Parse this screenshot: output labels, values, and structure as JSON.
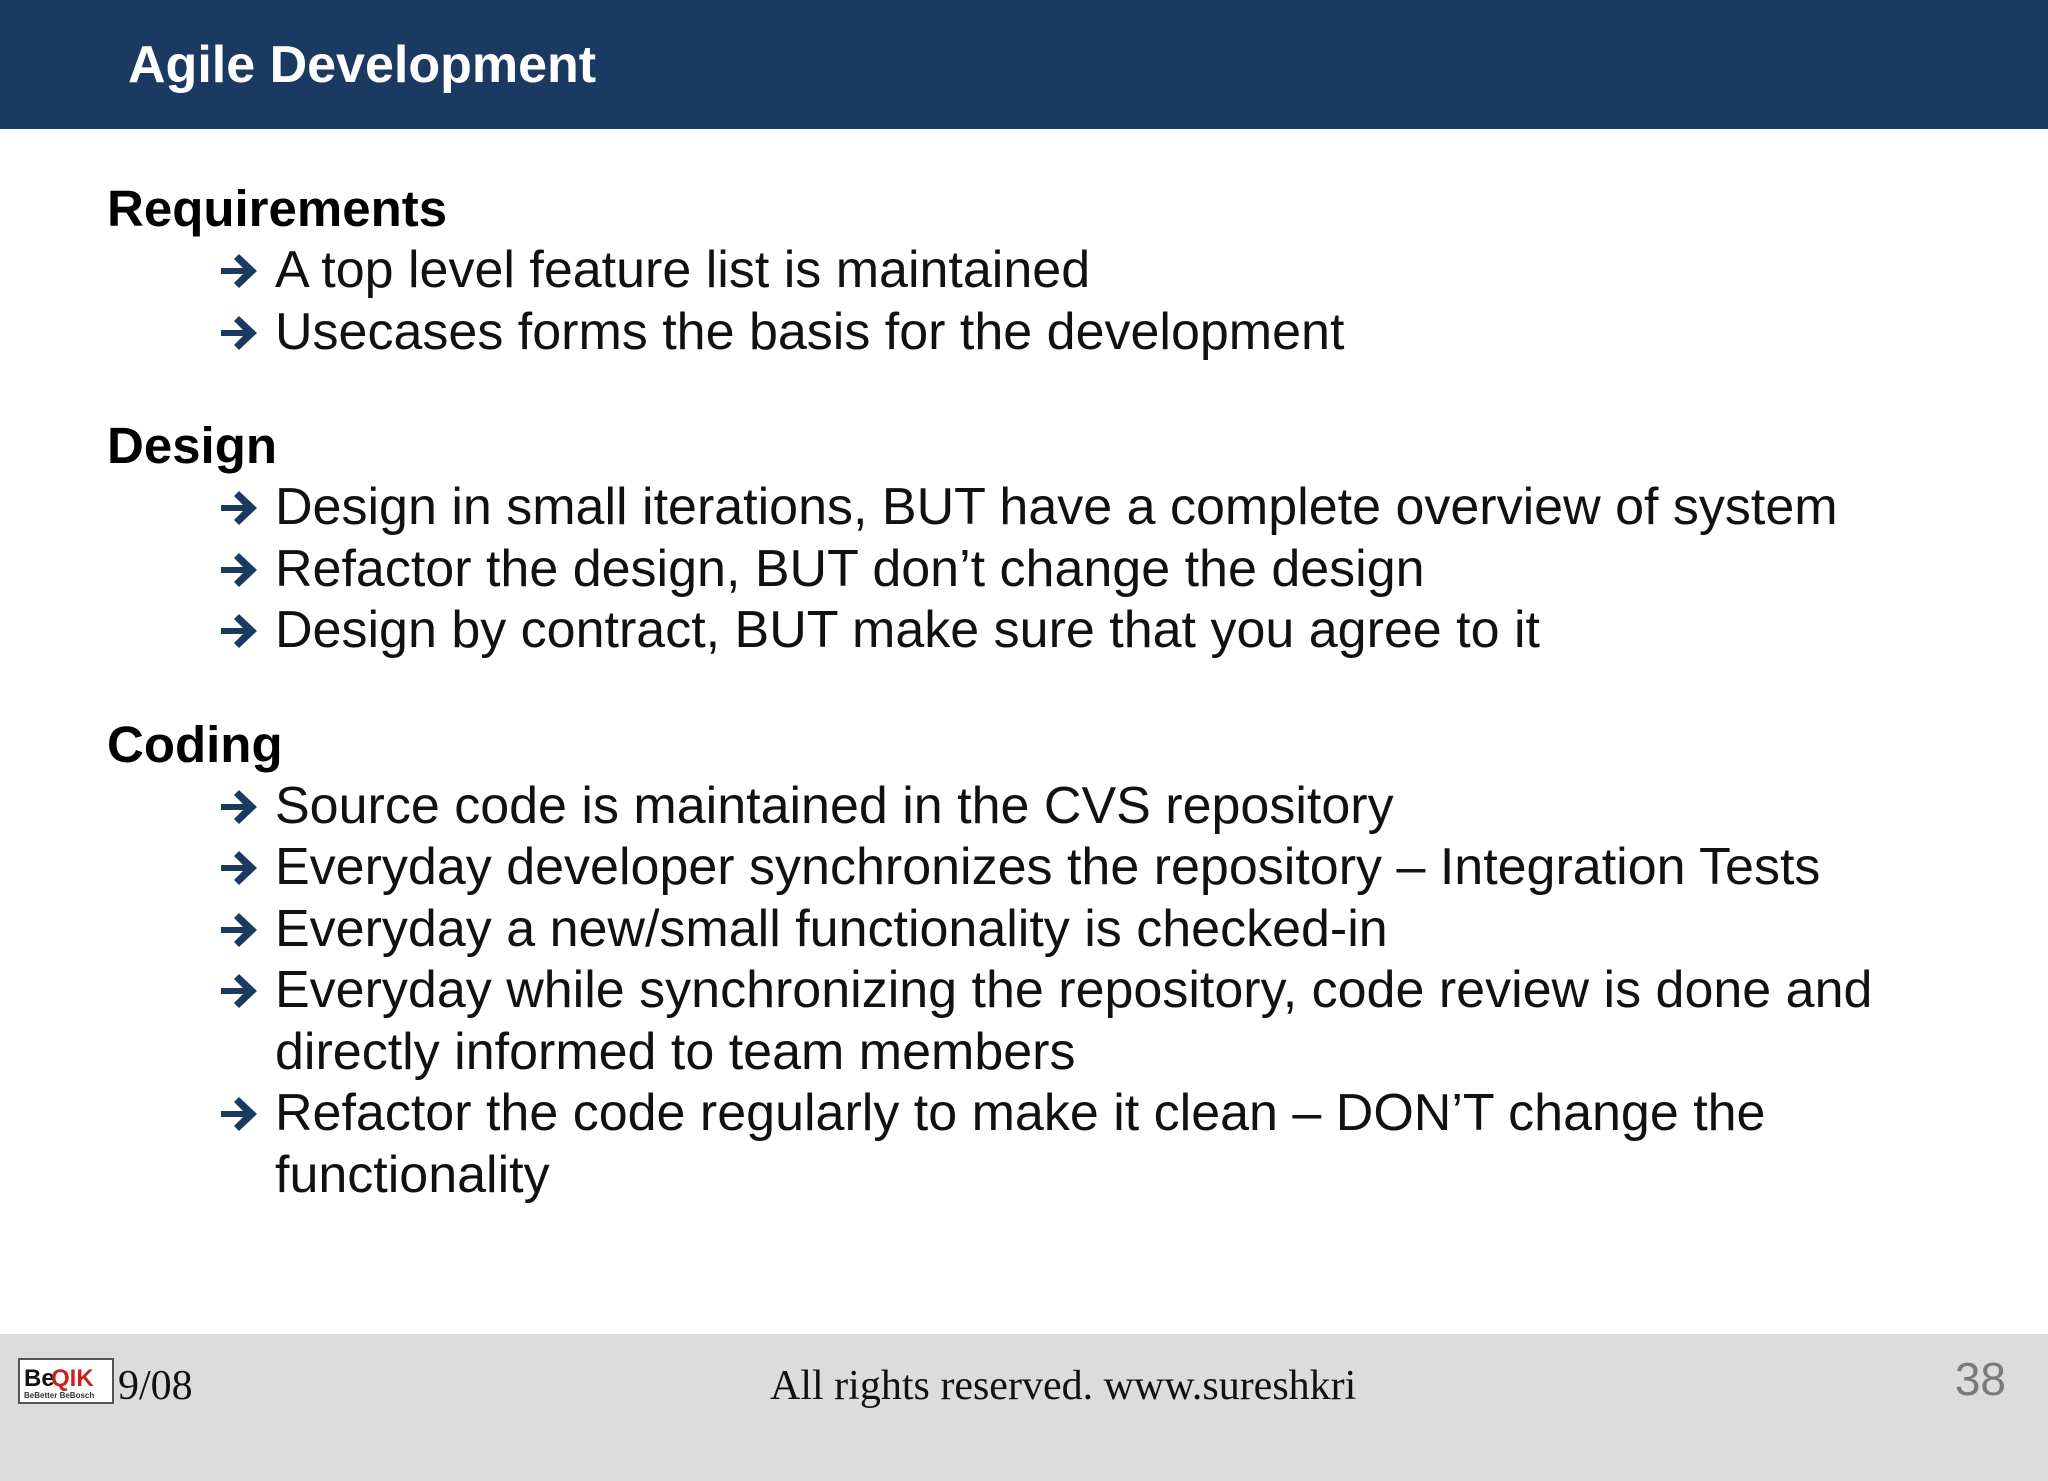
{
  "slide": {
    "title": "Agile Development",
    "sections": [
      {
        "heading": "Requirements",
        "bullets": [
          "A top level feature list is maintained",
          "Usecases forms the basis for the development"
        ]
      },
      {
        "heading": "Design",
        "bullets": [
          "Design in small iterations, BUT have a complete overview of system",
          "Refactor the design, BUT don’t change the design",
          "Design by contract, BUT make sure that you agree to it"
        ]
      },
      {
        "heading": "Coding",
        "bullets": [
          "Source code is maintained in the CVS repository",
          "Everyday developer synchronizes the repository – Integration Tests",
          "Everyday a new/small functionality is checked-in",
          "Everyday while synchronizing the  repository, code review is done and directly informed to team members",
          "Refactor the code regularly to make it clean – DON’T change the functionality"
        ]
      }
    ]
  },
  "footer": {
    "logo_text_be": "Be",
    "logo_text_qik": "QIK",
    "logo_tagline": "BeBetter BeBosch",
    "date": "9/08",
    "rights": "All rights reserved. www.sureshkri",
    "page_number": "38"
  },
  "colors": {
    "title_bar": "#1b3a62",
    "arrow": "#1b3a62",
    "footer_bg": "#dcdcdc",
    "logo_red": "#cc1f1f"
  },
  "icons": {
    "bullet": "right-arrow-icon"
  }
}
